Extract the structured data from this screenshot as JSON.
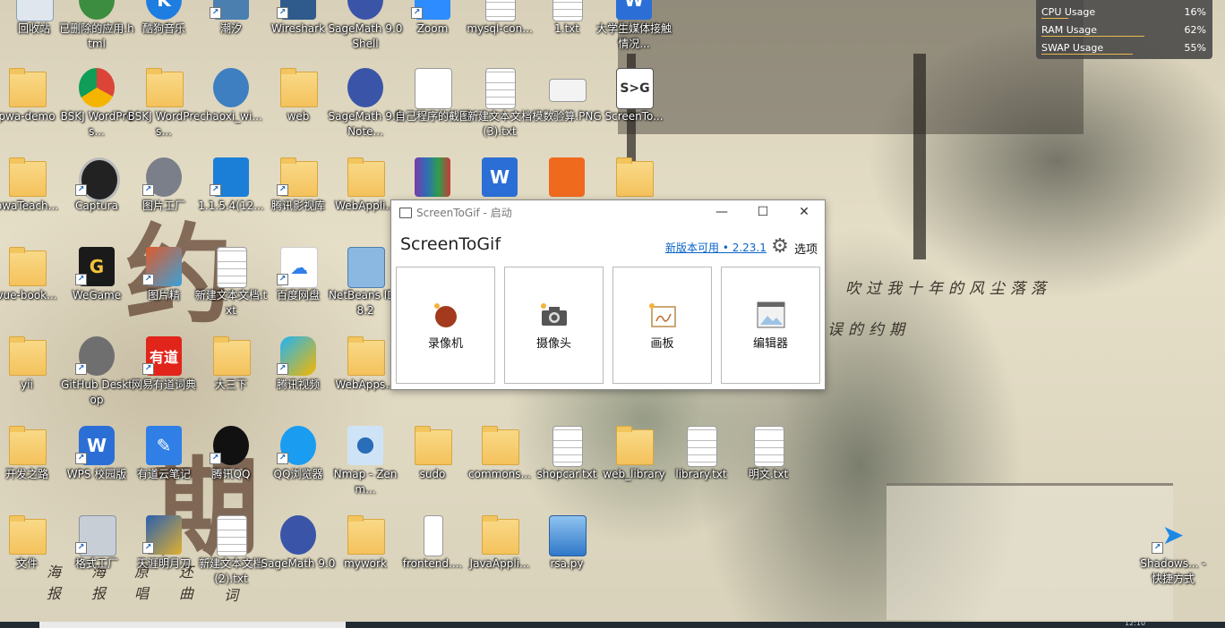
{
  "desktop": {
    "poem_line1": "吹过我十年的风尘落落",
    "poem_line2": "误的约期",
    "poem_line3": "海 报",
    "poem_line4": "海 报",
    "poem_line5": "原 唱",
    "poem_line6": "还 曲",
    "poem_line7": "词",
    "icons": [
      {
        "label": "回收站"
      },
      {
        "label": "已删除的应用.html"
      },
      {
        "label": "酷狗音乐"
      },
      {
        "label": "潮汐"
      },
      {
        "label": "Wireshark"
      },
      {
        "label": "SageMath 9.0 Shell"
      },
      {
        "label": "Zoom"
      },
      {
        "label": "mysql-con..."
      },
      {
        "label": "1.txt"
      },
      {
        "label": "大学生媒体接触情况..."
      },
      {
        "label": "pwa-demo"
      },
      {
        "label": "BSKJ WordPres..."
      },
      {
        "label": "BSKJ WordPres..."
      },
      {
        "label": "chaoxi_wi..."
      },
      {
        "label": "web"
      },
      {
        "label": "SageMath 9.0 Note..."
      },
      {
        "label": "自己程序的截图"
      },
      {
        "label": "新建文本文档 (3).txt"
      },
      {
        "label": "模数验算.PNG"
      },
      {
        "label": "ScreenTo..."
      },
      {
        "label": "owaTeach..."
      },
      {
        "label": "Captura"
      },
      {
        "label": "图片工厂"
      },
      {
        "label": "1.1.5.4(12..."
      },
      {
        "label": "腾讯影视库"
      },
      {
        "label": "WebAppli..."
      },
      {
        "label": "vue-book..."
      },
      {
        "label": "WeGame"
      },
      {
        "label": "图片精"
      },
      {
        "label": "新建文本文档.txt"
      },
      {
        "label": "百度网盘"
      },
      {
        "label": "NetBeans IDE 8.2"
      },
      {
        "label": "yii"
      },
      {
        "label": "GitHub Desktop"
      },
      {
        "label": "网易有道词典"
      },
      {
        "label": "大三下"
      },
      {
        "label": "腾讯视频"
      },
      {
        "label": "WebApps..."
      },
      {
        "label": "开发之路"
      },
      {
        "label": "WPS 校园版"
      },
      {
        "label": "有道云笔记"
      },
      {
        "label": "腾讯QQ"
      },
      {
        "label": "QQ浏览器"
      },
      {
        "label": "Nmap - Zenm..."
      },
      {
        "label": "sudo"
      },
      {
        "label": "commons..."
      },
      {
        "label": "shopcar.txt"
      },
      {
        "label": "web_library"
      },
      {
        "label": "library.txt"
      },
      {
        "label": "明文.txt"
      },
      {
        "label": "文件"
      },
      {
        "label": "格式工厂"
      },
      {
        "label": "天涯明月刀"
      },
      {
        "label": "新建文本文档 (2).txt"
      },
      {
        "label": "SageMath 9.0"
      },
      {
        "label": "mywork"
      },
      {
        "label": "frontend...."
      },
      {
        "label": "JavaAppli..."
      },
      {
        "label": "rsa.py"
      },
      {
        "label": "Shadows... - 快捷方式"
      }
    ]
  },
  "perf": {
    "cpu_label": "CPU Usage",
    "cpu_value": "16%",
    "cpu_fraction": 0.16,
    "ram_label": "RAM Usage",
    "ram_value": "62%",
    "ram_fraction": 0.62,
    "swap_label": "SWAP Usage",
    "swap_value": "55%",
    "swap_fraction": 0.55
  },
  "screentogif": {
    "window_title": "ScreenToGif - 启动",
    "heading": "ScreenToGif",
    "update_link": "新版本可用 • 2.23.1",
    "options_label": "选项",
    "tiles": [
      {
        "label": "录像机"
      },
      {
        "label": "摄像头"
      },
      {
        "label": "画板"
      },
      {
        "label": "编辑器"
      }
    ],
    "minimize_glyph": "—",
    "maximize_glyph": "☐",
    "close_glyph": "✕"
  },
  "taskbar": {
    "clock": "12:10"
  },
  "colors": {
    "accent": "#0a64c8",
    "perf_bar": "#e9b94a",
    "recorder_red": "#a33a1e"
  }
}
